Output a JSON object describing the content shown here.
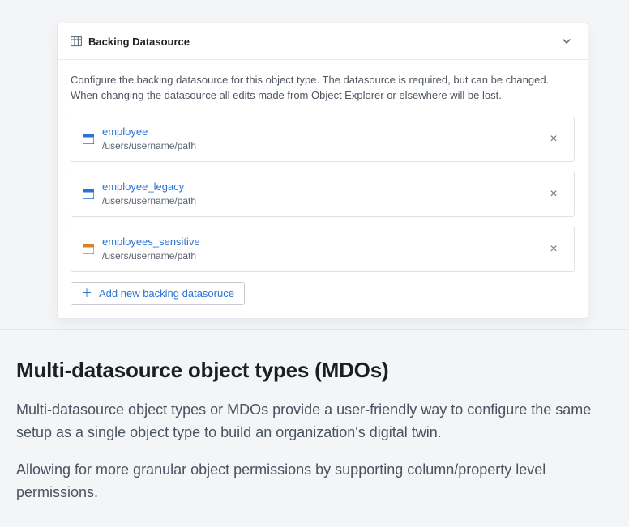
{
  "panel": {
    "title": "Backing Datasource",
    "helptext": "Configure the backing datasource for this object type. The datasource is required, but can be changed. When changing the datasource all edits made from Object Explorer or elsewhere will be lost."
  },
  "datasources": [
    {
      "icon": "dataset-blue",
      "name": "employee",
      "path": "/users/username/path"
    },
    {
      "icon": "dataset-blue",
      "name": "employee_legacy",
      "path": "/users/username/path"
    },
    {
      "icon": "dataset-orange",
      "name": "employees_sensitive",
      "path": "/users/username/path"
    }
  ],
  "add_button": "Add new backing datasoruce",
  "article": {
    "heading": "Multi-datasource object types (MDOs)",
    "p1": "Multi-datasource object types or MDOs provide a user-friendly way to configure the same setup as a single object type to build an organization's digital twin.",
    "p2": "Allowing for more granular object permissions by supporting column/property level permissions."
  },
  "icon_colors": {
    "dataset-blue": "#2d72d2",
    "dataset-orange": "#d9822b",
    "header-table": "#6b7380"
  }
}
